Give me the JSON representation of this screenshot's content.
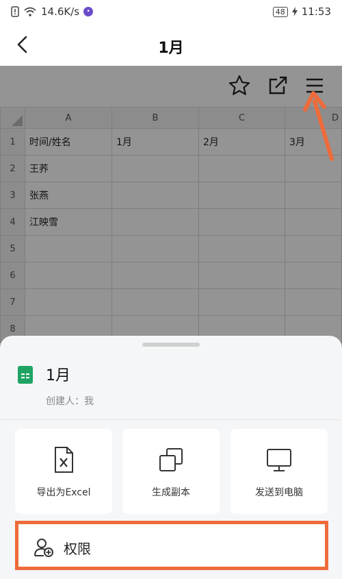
{
  "status_bar": {
    "speed": "14.6K/s",
    "battery": "48",
    "time": "11:53"
  },
  "nav": {
    "title": "1月",
    "back_icon": "chevron-left-icon"
  },
  "toolbar": {
    "icons": [
      "star-icon",
      "share-icon",
      "menu-icon"
    ]
  },
  "spreadsheet": {
    "columns": [
      "A",
      "B",
      "C",
      "D"
    ],
    "rows": [
      {
        "num": "1",
        "cells": [
          "时间/姓名",
          "1月",
          "2月",
          "3月"
        ]
      },
      {
        "num": "2",
        "cells": [
          "王荞",
          "",
          "",
          ""
        ]
      },
      {
        "num": "3",
        "cells": [
          "张燕",
          "",
          "",
          ""
        ]
      },
      {
        "num": "4",
        "cells": [
          "江映雪",
          "",
          "",
          ""
        ]
      },
      {
        "num": "5",
        "cells": [
          "",
          "",
          "",
          ""
        ]
      },
      {
        "num": "6",
        "cells": [
          "",
          "",
          "",
          ""
        ]
      },
      {
        "num": "7",
        "cells": [
          "",
          "",
          "",
          ""
        ]
      },
      {
        "num": "8",
        "cells": [
          "",
          "",
          "",
          ""
        ]
      }
    ]
  },
  "bottom_sheet": {
    "file_title": "1月",
    "creator": "创建人：我",
    "actions": [
      {
        "label": "导出为Excel",
        "icon": "excel-export-icon"
      },
      {
        "label": "生成副本",
        "icon": "copy-icon"
      },
      {
        "label": "发送到电脑",
        "icon": "monitor-icon"
      }
    ],
    "permission_label": "权限"
  },
  "colors": {
    "highlight": "#ee6b3b",
    "sheet_icon": "#1fa463"
  }
}
